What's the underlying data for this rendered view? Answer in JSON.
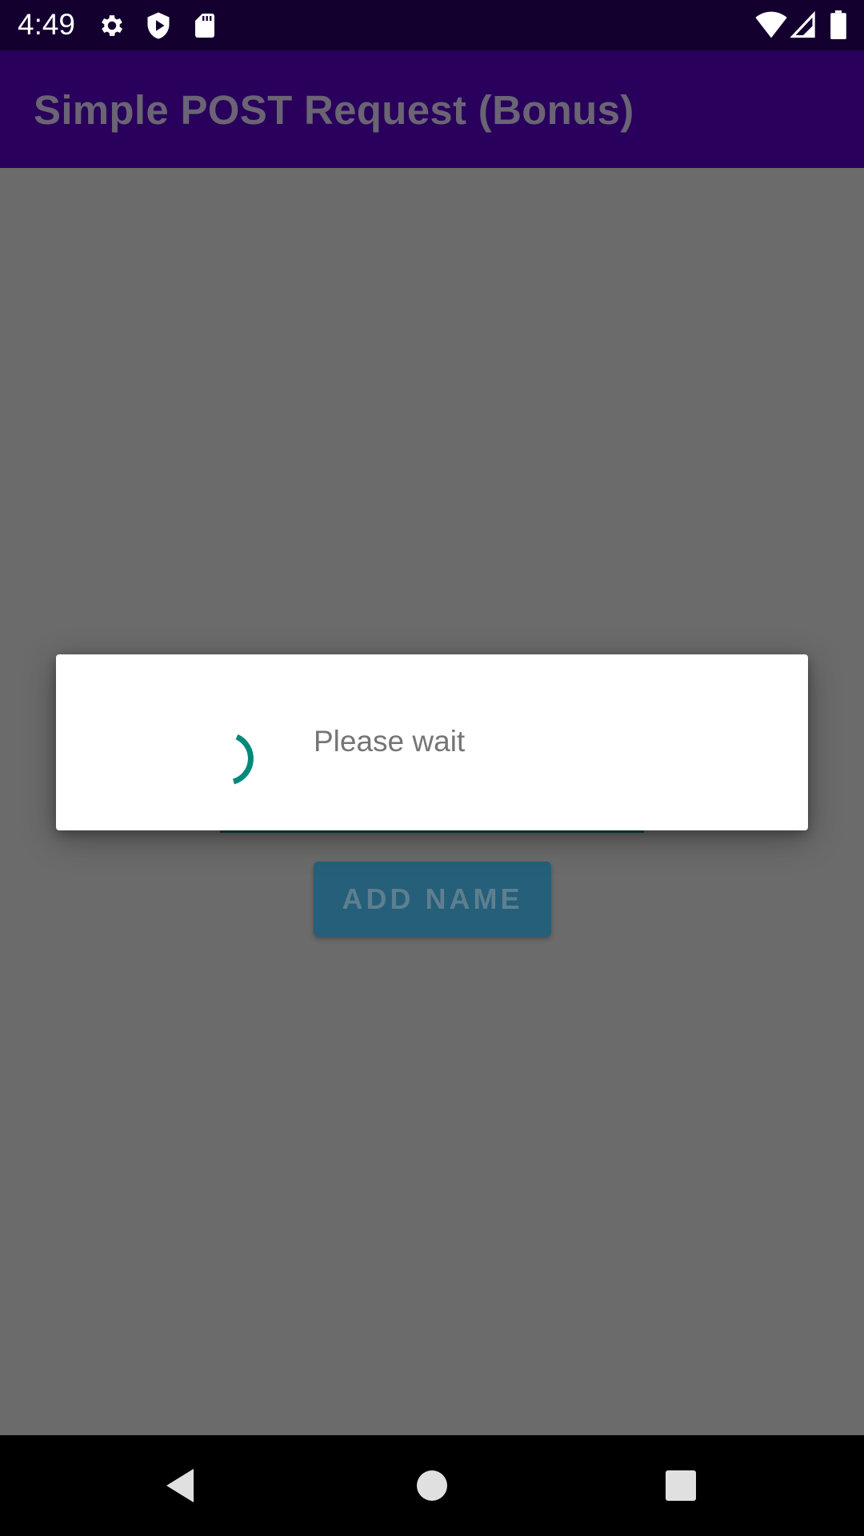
{
  "status_bar": {
    "time": "4:49",
    "left_icons": [
      "settings-icon",
      "play-protect-icon",
      "sd-card-icon"
    ],
    "right_icons": [
      "wifi-icon",
      "cell-signal-icon",
      "battery-icon"
    ]
  },
  "app_bar": {
    "title": "Simple POST Request (Bonus)"
  },
  "content": {
    "add_button_label": "ADD NAME"
  },
  "dialog": {
    "message": "Please wait",
    "spinner_icon": "progress-spinner-icon"
  },
  "nav_bar": {
    "buttons": [
      "back-icon",
      "home-icon",
      "recents-icon"
    ]
  },
  "colors": {
    "status_bar": "#13002f",
    "app_bar": "#29005c",
    "scrim": "#6b6b6b",
    "accent": "#00897b",
    "button": "#255f7a"
  }
}
